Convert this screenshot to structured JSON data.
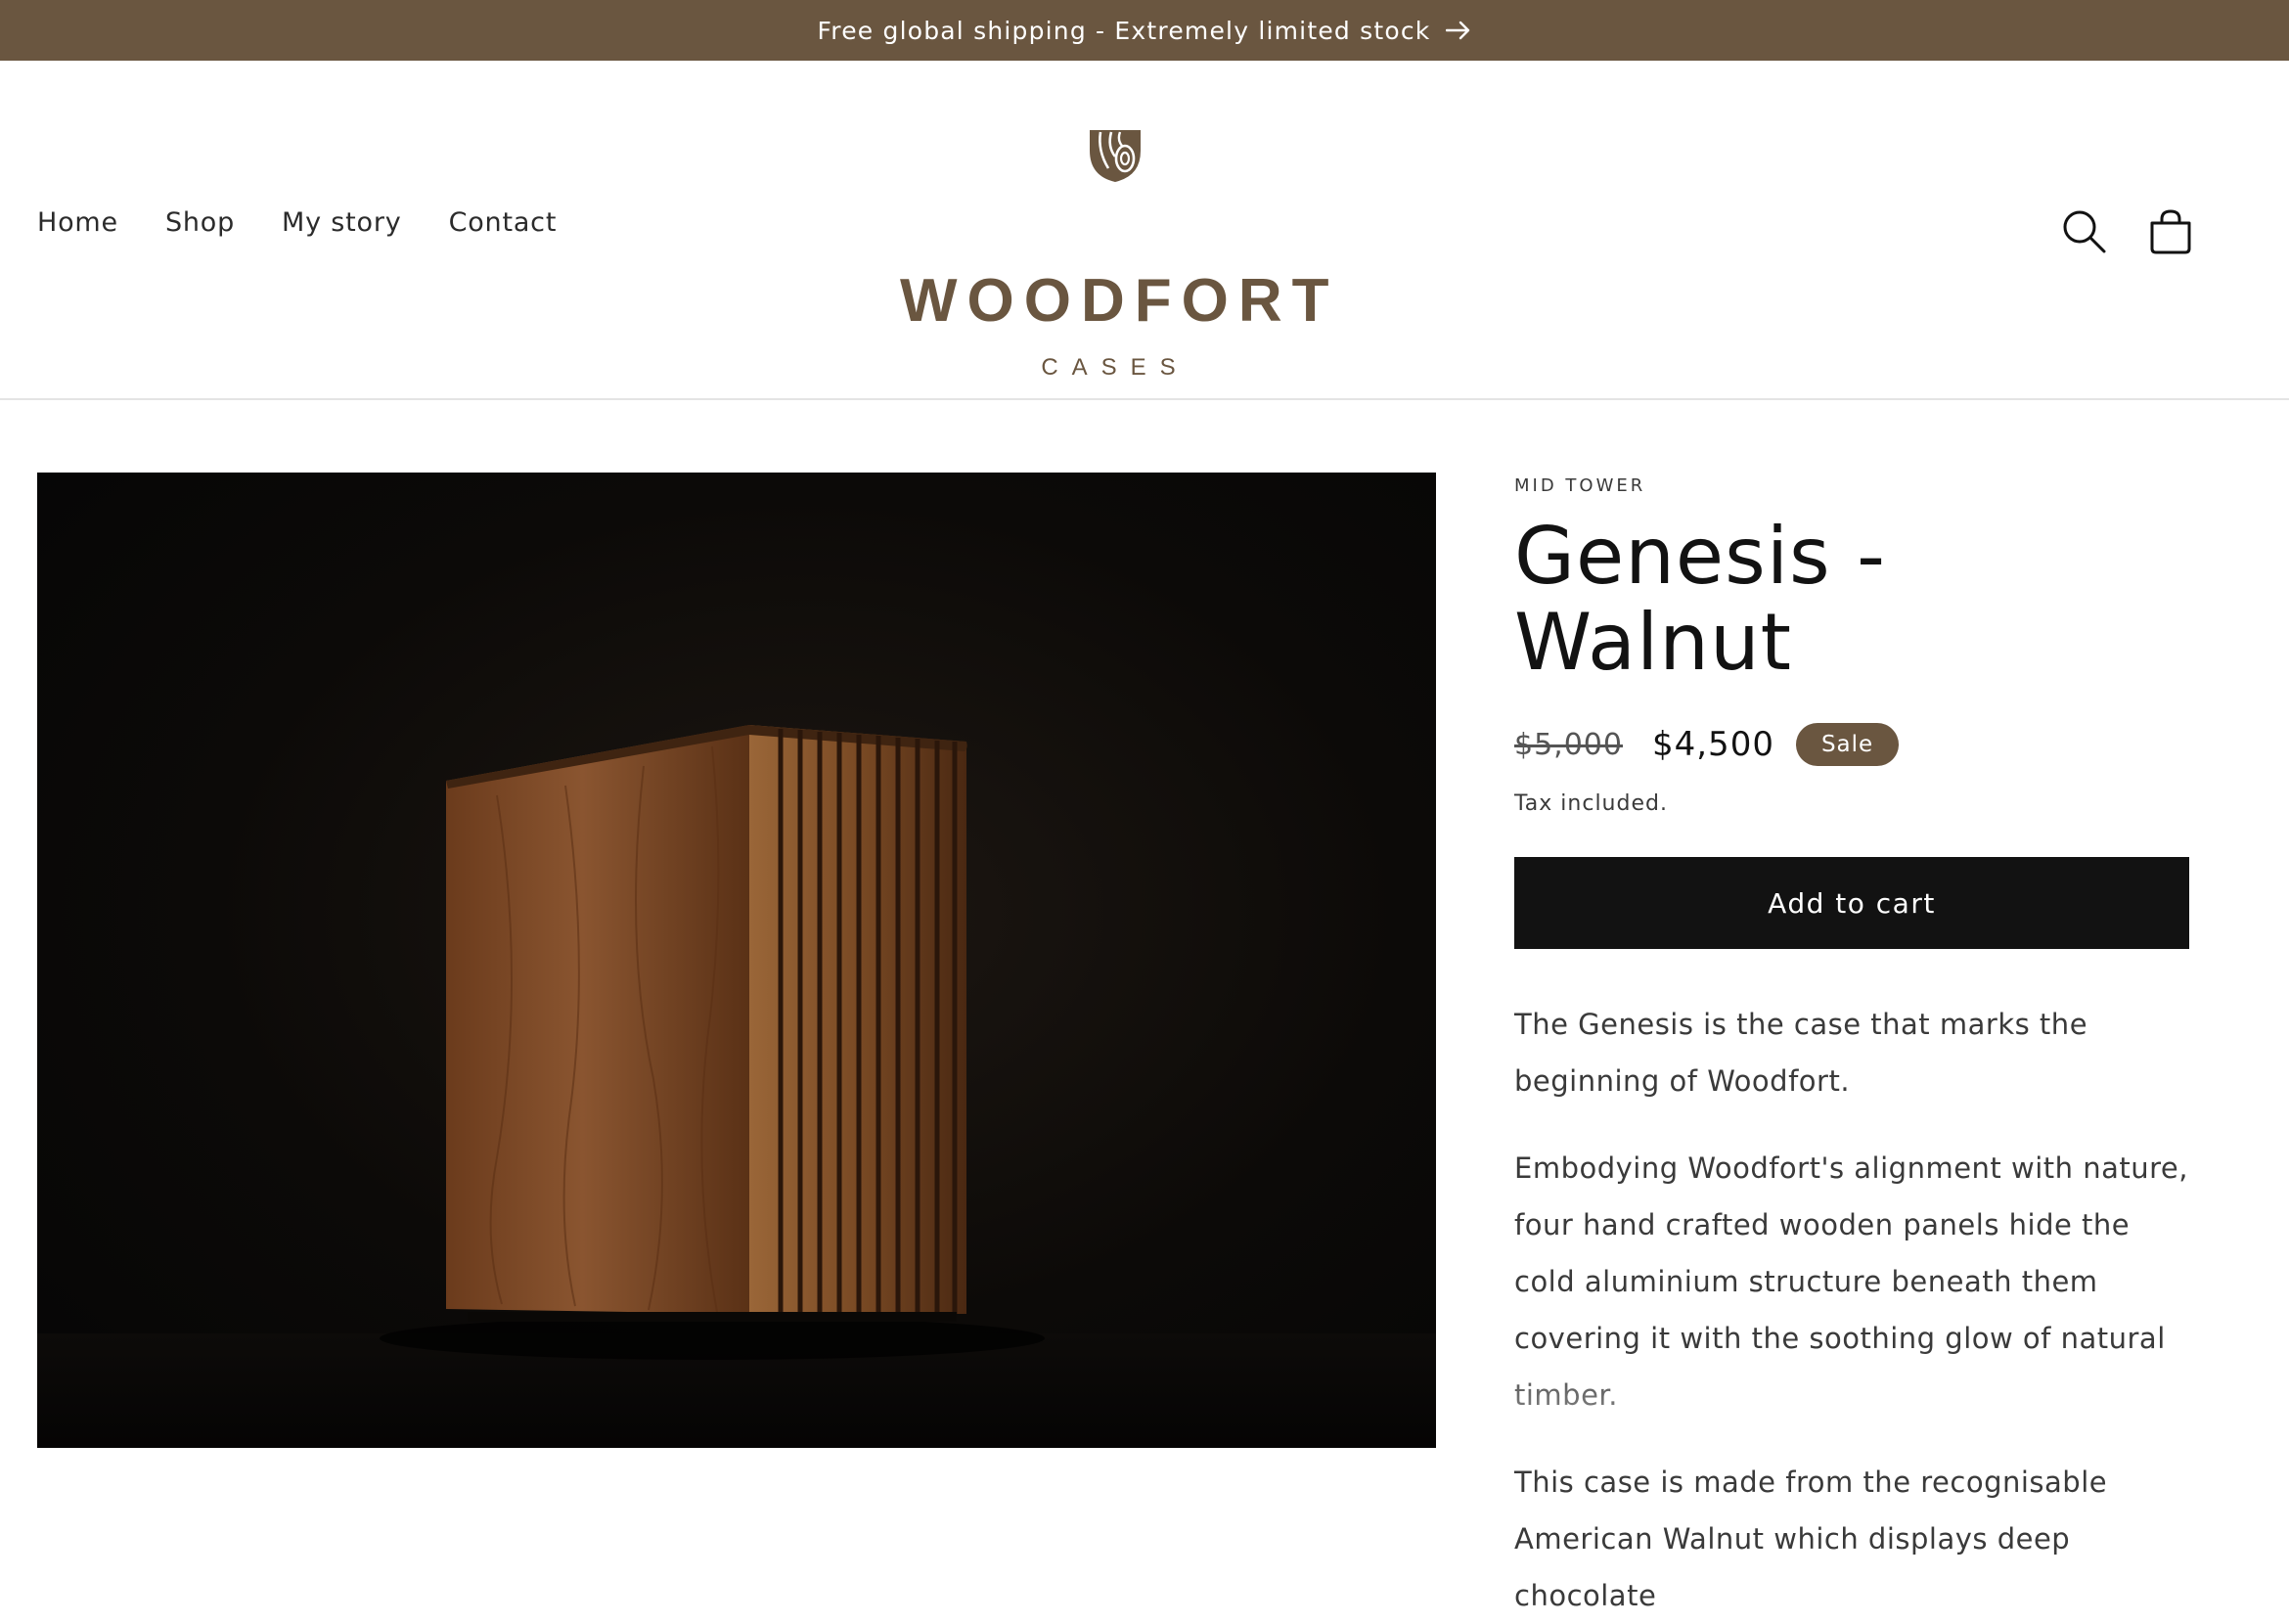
{
  "announcement": {
    "text": "Free global shipping - Extremely limited stock"
  },
  "nav": {
    "items": [
      {
        "label": "Home"
      },
      {
        "label": "Shop"
      },
      {
        "label": "My story"
      },
      {
        "label": "Contact"
      }
    ]
  },
  "logo": {
    "main": "WOODFORT",
    "sub": "CASES"
  },
  "product": {
    "vendor": "MID TOWER",
    "title": "Genesis - Walnut",
    "price_regular": "$5,000",
    "price_sale": "$4,500",
    "badge": "Sale",
    "tax_note": "Tax included.",
    "add_to_cart": "Add to cart",
    "description": [
      "The Genesis is the case that marks the beginning of Woodfort.",
      "Embodying Woodfort's alignment with nature, four hand crafted wooden panels hide the cold aluminium structure beneath them covering it with the soothing glow of natural timber.",
      "This case is made from the recognisable American Walnut which displays deep chocolate"
    ]
  },
  "icons": {
    "search": "search-icon",
    "cart": "cart-icon",
    "arrow": "arrow-right-icon",
    "logo_mark": "wood-grain-logo-icon"
  },
  "colors": {
    "brand": "#6a5640",
    "button": "#121212",
    "text": "#3a3a3a"
  }
}
